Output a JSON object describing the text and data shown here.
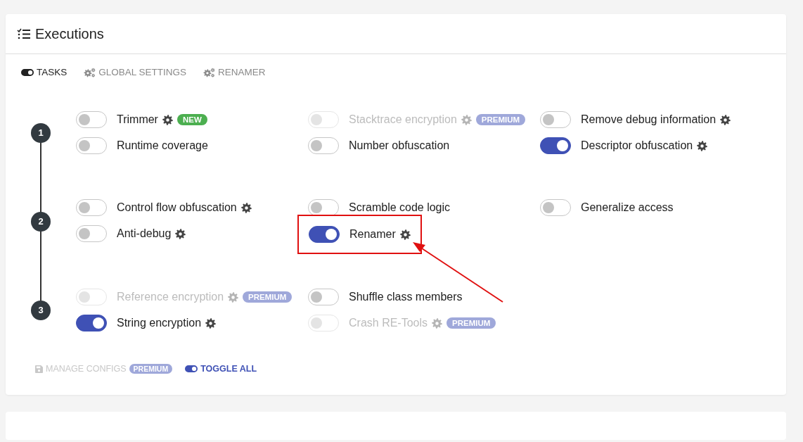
{
  "card": {
    "title": "Executions"
  },
  "tabs": [
    {
      "label": "TASKS",
      "selected": true
    },
    {
      "label": "GLOBAL SETTINGS",
      "selected": false
    },
    {
      "label": "RENAMER",
      "selected": false
    }
  ],
  "steps": [
    {
      "number": "1",
      "columns": [
        [
          {
            "label": "Trimmer",
            "on": false,
            "disabled": false,
            "settings": true,
            "badge": {
              "kind": "new",
              "text": "NEW"
            }
          },
          {
            "label": "Runtime coverage",
            "on": false,
            "disabled": false,
            "settings": false
          }
        ],
        [
          {
            "label": "Stacktrace encryption",
            "on": false,
            "disabled": true,
            "settings": true,
            "badge": {
              "kind": "premium",
              "text": "PREMIUM"
            }
          },
          {
            "label": "Number obfuscation",
            "on": false,
            "disabled": false,
            "settings": false
          }
        ],
        [
          {
            "label": "Remove debug information",
            "on": false,
            "disabled": false,
            "settings": true
          },
          {
            "label": "Descriptor obfuscation",
            "on": true,
            "disabled": false,
            "settings": true
          }
        ]
      ]
    },
    {
      "number": "2",
      "columns": [
        [
          {
            "label": "Control flow obfuscation",
            "on": false,
            "disabled": false,
            "settings": true
          },
          {
            "label": "Anti-debug",
            "on": false,
            "disabled": false,
            "settings": true
          }
        ],
        [
          {
            "label": "Scramble code logic",
            "on": false,
            "disabled": false,
            "settings": false
          },
          {
            "label": "Renamer",
            "on": true,
            "disabled": false,
            "settings": true,
            "highlighted": true
          }
        ],
        [
          {
            "label": "Generalize access",
            "on": false,
            "disabled": false,
            "settings": false
          }
        ]
      ]
    },
    {
      "number": "3",
      "columns": [
        [
          {
            "label": "Reference encryption",
            "on": false,
            "disabled": true,
            "settings": true,
            "badge": {
              "kind": "premium",
              "text": "PREMIUM"
            }
          },
          {
            "label": "String encryption",
            "on": true,
            "disabled": false,
            "settings": true
          }
        ],
        [
          {
            "label": "Shuffle class members",
            "on": false,
            "disabled": false,
            "settings": false
          },
          {
            "label": "Crash RE-Tools",
            "on": false,
            "disabled": true,
            "settings": true,
            "badge": {
              "kind": "premium",
              "text": "PREMIUM"
            }
          }
        ]
      ]
    }
  ],
  "footer": [
    {
      "kind": "manage",
      "label": "MANAGE CONFIGS",
      "disabled": true,
      "badge": {
        "kind": "premium",
        "text": "PREMIUM"
      }
    },
    {
      "kind": "toggle",
      "label": "TOGGLE ALL",
      "disabled": false
    }
  ]
}
